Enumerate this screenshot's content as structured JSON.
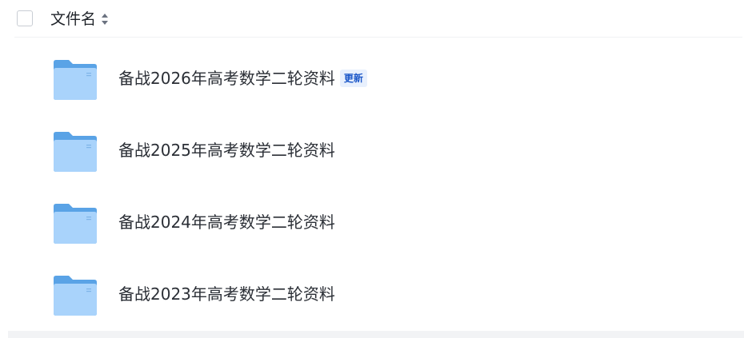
{
  "header": {
    "column_title": "文件名",
    "sort_icon": "sort-icon"
  },
  "files": [
    {
      "name": "备战2026年高考数学二轮资料",
      "badge": "更新",
      "icon": "folder-icon"
    },
    {
      "name": "备战2025年高考数学二轮资料",
      "badge": "",
      "icon": "folder-icon"
    },
    {
      "name": "备战2024年高考数学二轮资料",
      "badge": "",
      "icon": "folder-icon"
    },
    {
      "name": "备战2023年高考数学二轮资料",
      "badge": "",
      "icon": "folder-icon"
    }
  ],
  "colors": {
    "folder_back": "#5aa3e6",
    "folder_front": "#a9d3fb",
    "badge_text": "#1a56c8",
    "badge_bg": "#e8f0fd"
  }
}
